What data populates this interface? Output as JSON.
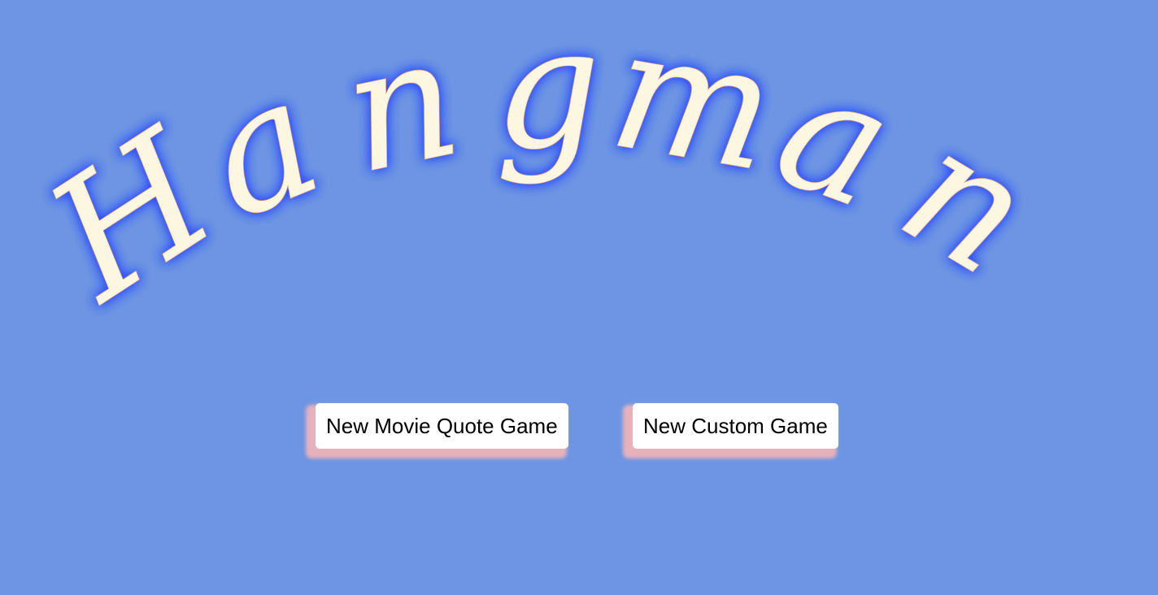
{
  "title": {
    "text": "Hangman",
    "letter_color": "#fdf6e0",
    "glow_color": "#2e4cff"
  },
  "background_color": "#6d95e3",
  "buttons": {
    "movie_quote_label": "New Movie Quote Game",
    "custom_label": "New Custom Game",
    "shadow_color": "#e6b1bb"
  }
}
